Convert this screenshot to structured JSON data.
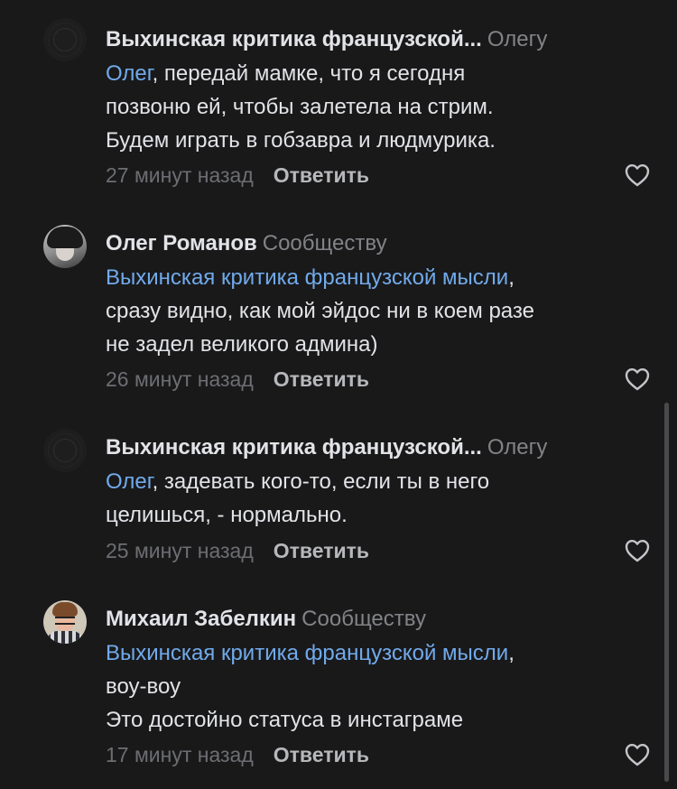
{
  "comments": [
    {
      "author": "Выхинская критика французской...",
      "target": "Олегу",
      "mention": "Олег",
      "text_lines": [
        ", передай мамке, что я сегодня",
        "позвоню ей, чтобы залетела на стрим.",
        "Будем играть в гобзавра и людмурика."
      ],
      "time": "27 минут назад",
      "reply_label": "Ответить",
      "like_icon": "heart-outline-icon"
    },
    {
      "author": "Олег Романов",
      "target": "Сообществу",
      "mention": "Выхинская критика французской мысли",
      "text_lines": [
        ",",
        "сразу видно, как мой эйдос ни в коем разе",
        "не задел великого админа)"
      ],
      "time": "26 минут назад",
      "reply_label": "Ответить",
      "like_icon": "heart-outline-icon"
    },
    {
      "author": "Выхинская критика французской...",
      "target": "Олегу",
      "mention": "Олег",
      "text_lines": [
        ", задевать кого-то, если ты в него",
        "целишься, - нормально."
      ],
      "time": "25 минут назад",
      "reply_label": "Ответить",
      "like_icon": "heart-outline-icon"
    },
    {
      "author": "Михаил Забелкин",
      "target": "Сообществу",
      "mention": "Выхинская критика французской мысли",
      "text_lines": [
        ",",
        "воу-воу",
        "Это достойно статуса в инстаграме"
      ],
      "time": "17 минут назад",
      "reply_label": "Ответить",
      "like_icon": "heart-outline-icon"
    }
  ],
  "colors": {
    "background": "#19191a",
    "text": "#e2e3e7",
    "link": "#71aaeb",
    "secondary": "#828387"
  }
}
